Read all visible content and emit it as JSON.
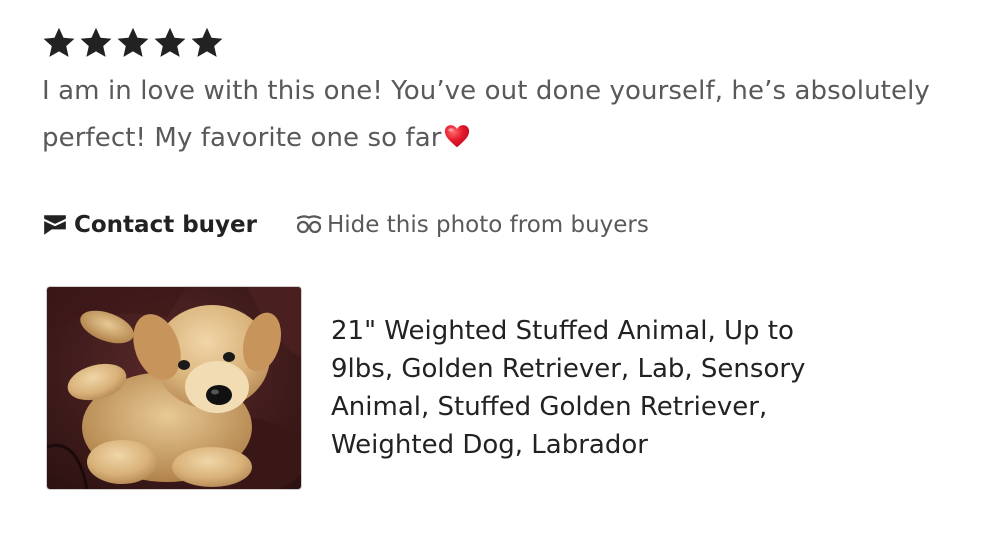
{
  "review": {
    "rating": 5,
    "rating_max": 5,
    "text": "I am in love with this one! You’ve out done yourself, he’s absolutely perfect! My favorite one so far",
    "emoji": "red-heart"
  },
  "actions": {
    "contact_label": "Contact buyer",
    "hide_photo_label": "Hide this photo from buyers"
  },
  "listing": {
    "title": "21\" Weighted Stuffed Animal, Up to 9lbs, Golden Retriever, Lab, Sensory Animal, Stuffed Golden Retriever, Weighted Dog, Labrador",
    "image_subject": "golden-retriever-plush-photo"
  },
  "colors": {
    "star": "#222222",
    "review_text": "#595959",
    "heart": "#e5182c"
  }
}
